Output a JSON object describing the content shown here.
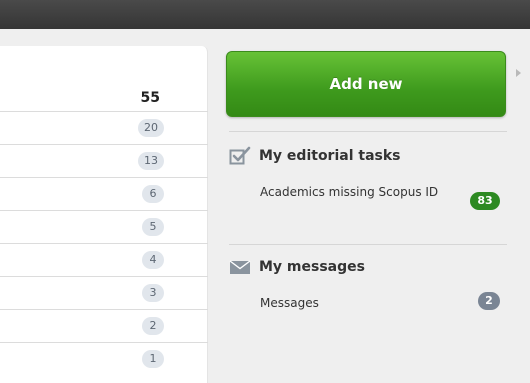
{
  "left_panel": {
    "header_value": "55",
    "rows": [
      "20",
      "13",
      "6",
      "5",
      "4",
      "3",
      "2",
      "1"
    ]
  },
  "actions": {
    "add_new_label": "Add new"
  },
  "editorial": {
    "title": "My editorial tasks",
    "icon": "checkbox-icon",
    "item_label": "Academics missing Scopus ID",
    "item_count": "83"
  },
  "messages": {
    "title": "My messages",
    "icon": "envelope-icon",
    "item_label": "Messages",
    "item_count": "2"
  },
  "colors": {
    "topbar": "#3f3f3f",
    "add_button": "#48a622",
    "badge_green": "#2d8a22",
    "badge_gray": "#7a8594",
    "count_pill": "#e1e6ec"
  }
}
